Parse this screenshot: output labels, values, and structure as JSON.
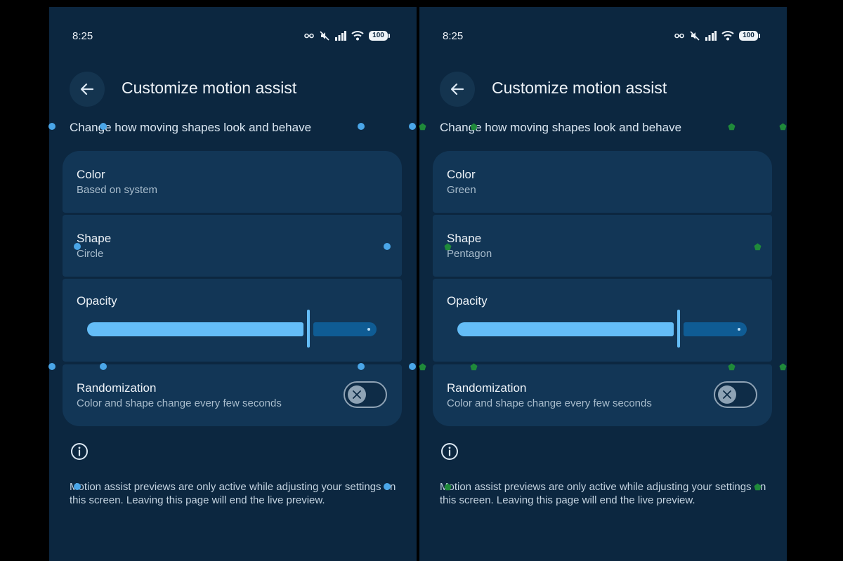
{
  "screens": [
    {
      "status": {
        "time": "8:25",
        "battery": "100"
      },
      "header": {
        "title": "Customize motion assist"
      },
      "subtitle": "Change how moving shapes look and behave",
      "settings": {
        "color": {
          "label": "Color",
          "value": "Based on system"
        },
        "shape": {
          "label": "Shape",
          "value": "Circle"
        },
        "opacity": {
          "label": "Opacity",
          "level": 0.76
        },
        "randomization": {
          "label": "Randomization",
          "description": "Color and shape change every few seconds",
          "enabled": false
        }
      },
      "footer_note": "Motion assist previews are only active while adjusting your settings on this screen. Leaving this page will end the live preview.",
      "overlay_marker": {
        "shape": "circle",
        "color": "#4aa6e8"
      }
    },
    {
      "status": {
        "time": "8:25",
        "battery": "100"
      },
      "header": {
        "title": "Customize motion assist"
      },
      "subtitle": "Change how moving shapes look and behave",
      "settings": {
        "color": {
          "label": "Color",
          "value": "Green"
        },
        "shape": {
          "label": "Shape",
          "value": "Pentagon"
        },
        "opacity": {
          "label": "Opacity",
          "level": 0.76
        },
        "randomization": {
          "label": "Randomization",
          "description": "Color and shape change every few seconds",
          "enabled": false
        }
      },
      "footer_note": "Motion assist previews are only active while adjusting your settings on this screen. Leaving this page will end the live preview.",
      "overlay_marker": {
        "shape": "pentagon",
        "color": "#1f8a3a"
      }
    }
  ],
  "theme": {
    "background": "#0c2740",
    "card": "#123656",
    "accent": "#64bdf7",
    "track_inactive": "#0f5c94"
  }
}
